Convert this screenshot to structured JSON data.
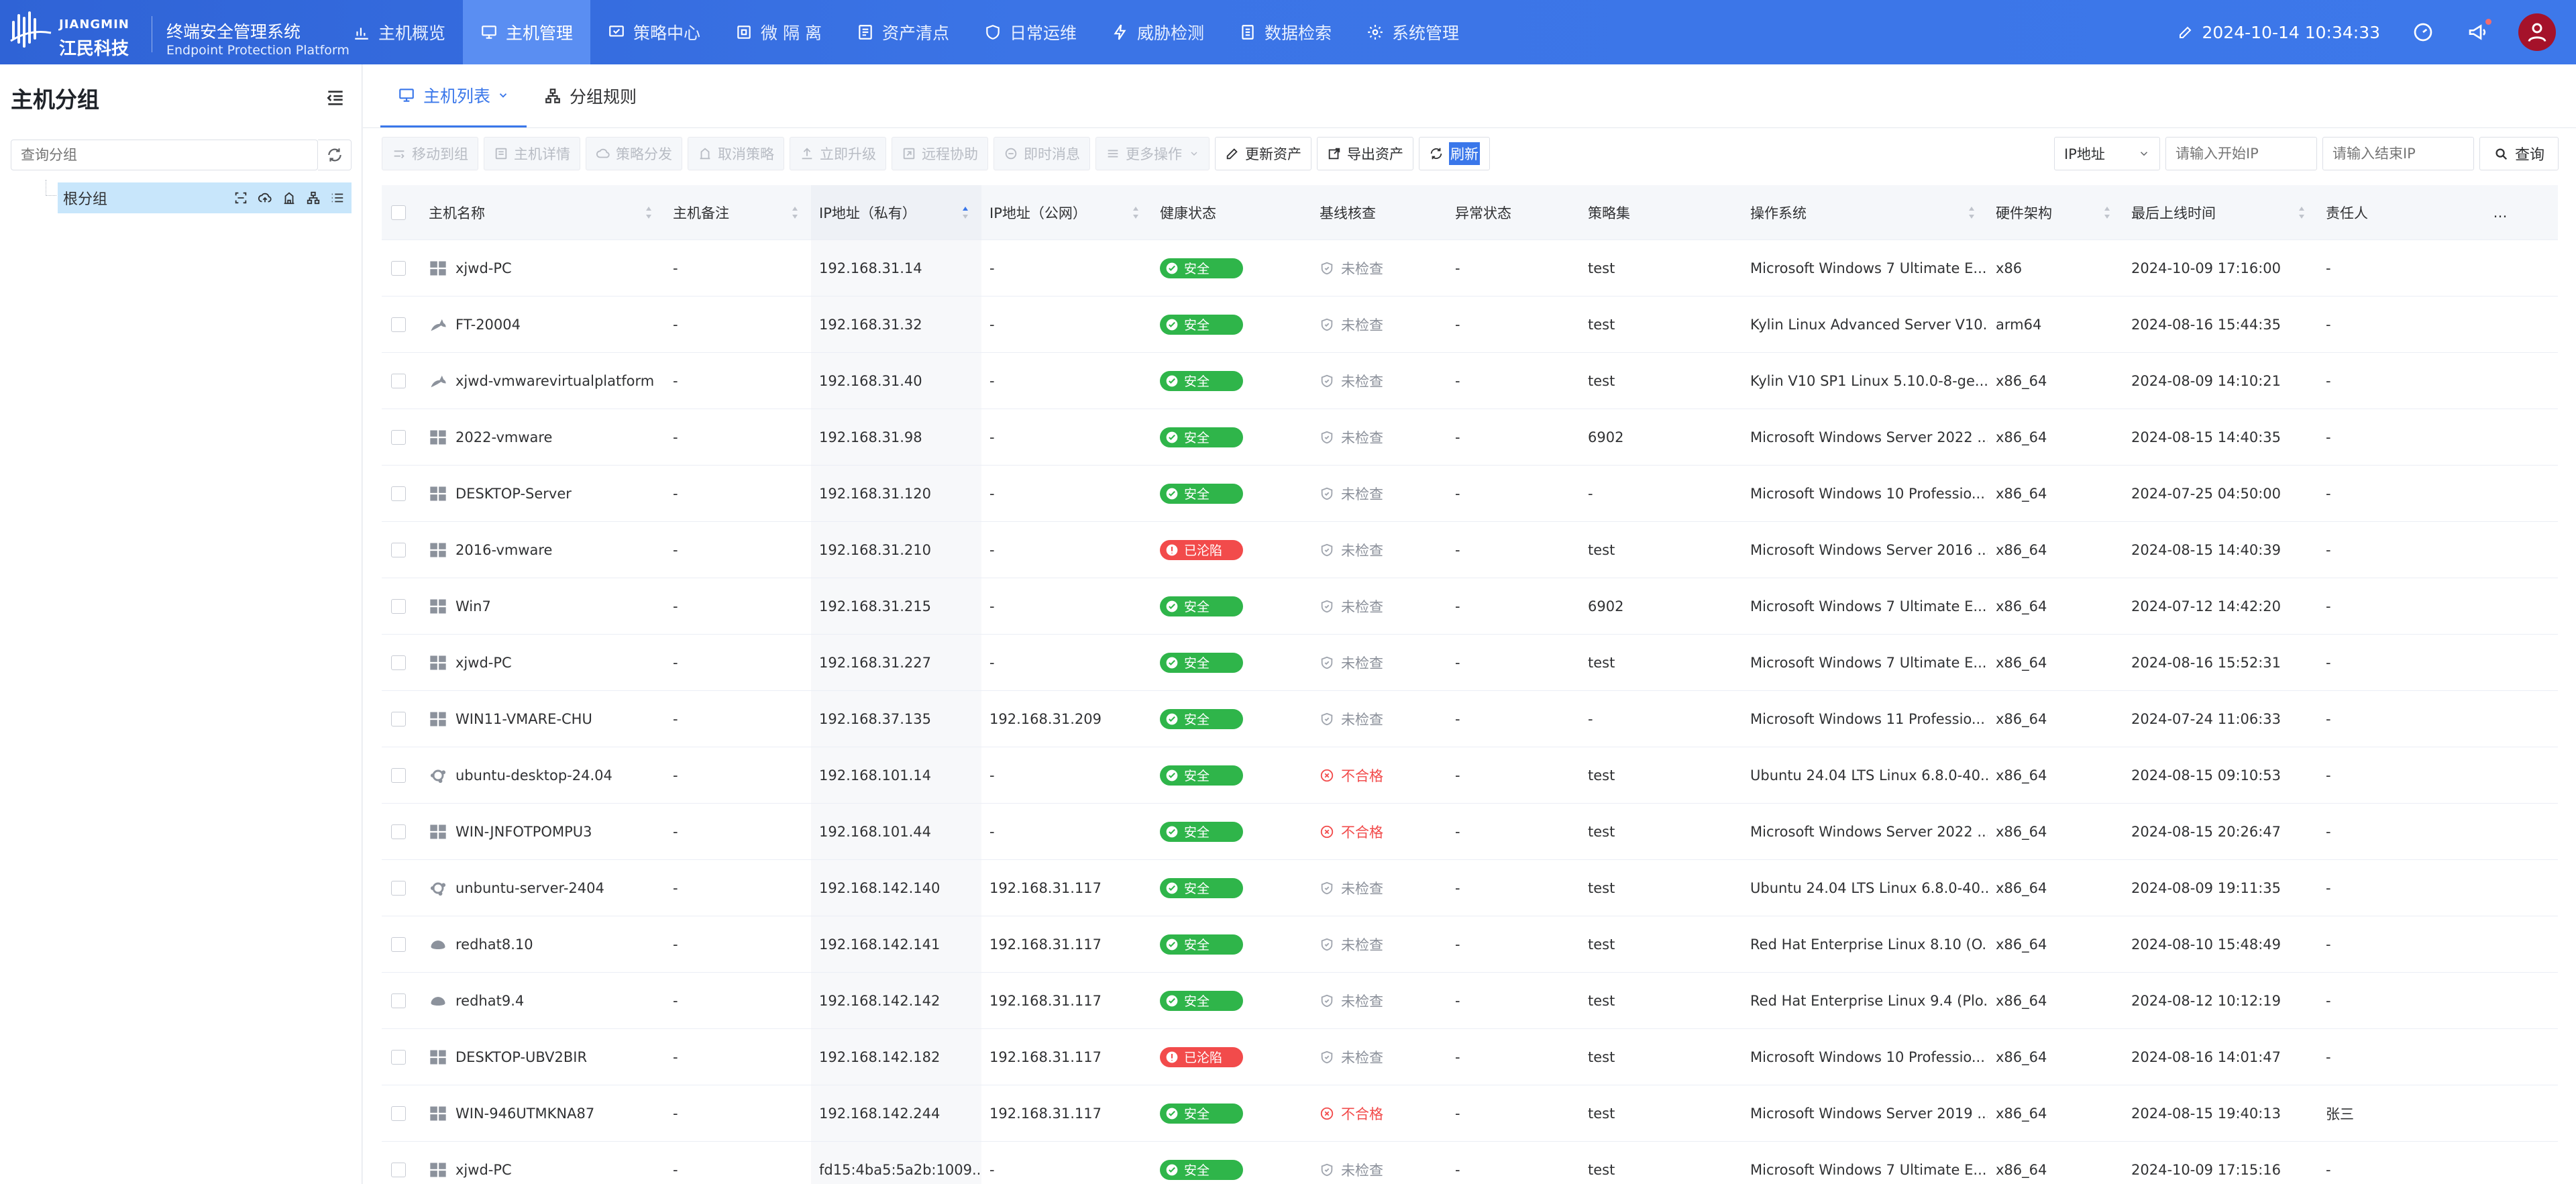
{
  "brand": {
    "name_cn": "江民科技",
    "name_en": "JIANGMIN",
    "product_cn": "终端安全管理系统",
    "product_en": "Endpoint Protection Platform"
  },
  "nav": [
    {
      "label": "主机概览",
      "icon": "bar-chart-icon"
    },
    {
      "label": "主机管理",
      "icon": "monitor-icon",
      "active": true
    },
    {
      "label": "策略中心",
      "icon": "policy-icon"
    },
    {
      "label": "微 隔 离",
      "icon": "isolation-icon"
    },
    {
      "label": "资产清点",
      "icon": "asset-icon"
    },
    {
      "label": "日常运维",
      "icon": "shield-icon"
    },
    {
      "label": "威胁检测",
      "icon": "lightning-icon"
    },
    {
      "label": "数据检索",
      "icon": "document-icon"
    },
    {
      "label": "系统管理",
      "icon": "gear-icon"
    }
  ],
  "header": {
    "datetime": "2024-10-14 10:34:33"
  },
  "sidebar": {
    "title": "主机分组",
    "search_placeholder": "查询分组",
    "root_group": "根分组"
  },
  "tabs": [
    {
      "label": "主机列表",
      "active": true
    },
    {
      "label": "分组规则"
    }
  ],
  "toolbar": {
    "move_group": "移动到组",
    "host_detail": "主机详情",
    "policy_dispatch": "策略分发",
    "cancel_policy": "取消策略",
    "upgrade_now": "立即升级",
    "remote_assist": "远程协助",
    "instant_msg": "即时消息",
    "more_actions": "更多操作",
    "update_assets": "更新资产",
    "export_assets": "导出资产",
    "refresh": "刷新"
  },
  "filters": {
    "ip_type": "IP地址",
    "start_ip_placeholder": "请输入开始IP",
    "end_ip_placeholder": "请输入结束IP",
    "query": "查询"
  },
  "columns": [
    "主机名称",
    "主机备注",
    "IP地址（私有）",
    "IP地址（公网）",
    "健康状态",
    "基线核查",
    "异常状态",
    "策略集",
    "操作系统",
    "硬件架构",
    "最后上线时间",
    "责任人",
    "…"
  ],
  "colors": {
    "accent": "#3a77ea",
    "safe": "#2fb54a",
    "danger": "#f24b4b"
  },
  "rows": [
    {
      "os": "windows",
      "name": "xjwd-PC",
      "note": "-",
      "ip_private": "192.168.31.14",
      "ip_public": "-",
      "health": "安全",
      "health_state": "ok",
      "baseline": "未检查",
      "baseline_state": "unchecked",
      "abnormal": "-",
      "policy": "test",
      "os_name": "Microsoft Windows 7 Ultimate E...",
      "arch": "x86",
      "last_online": "2024-10-09 17:16:00",
      "owner": "-"
    },
    {
      "os": "kylin",
      "name": "FT-20004",
      "note": "-",
      "ip_private": "192.168.31.32",
      "ip_public": "-",
      "health": "安全",
      "health_state": "ok",
      "baseline": "未检查",
      "baseline_state": "unchecked",
      "abnormal": "-",
      "policy": "test",
      "os_name": "Kylin Linux Advanced Server V10...",
      "arch": "arm64",
      "last_online": "2024-08-16 15:44:35",
      "owner": "-"
    },
    {
      "os": "kylin",
      "name": "xjwd-vmwarevirtualplatform",
      "note": "-",
      "ip_private": "192.168.31.40",
      "ip_public": "-",
      "health": "安全",
      "health_state": "ok",
      "baseline": "未检查",
      "baseline_state": "unchecked",
      "abnormal": "-",
      "policy": "test",
      "os_name": "Kylin V10 SP1 Linux 5.10.0-8-ge...",
      "arch": "x86_64",
      "last_online": "2024-08-09 14:10:21",
      "owner": "-"
    },
    {
      "os": "windows",
      "name": "2022-vmware",
      "note": "-",
      "ip_private": "192.168.31.98",
      "ip_public": "-",
      "health": "安全",
      "health_state": "ok",
      "baseline": "未检查",
      "baseline_state": "unchecked",
      "abnormal": "-",
      "policy": "6902",
      "os_name": "Microsoft Windows Server 2022 ...",
      "arch": "x86_64",
      "last_online": "2024-08-15 14:40:35",
      "owner": "-"
    },
    {
      "os": "windows",
      "name": "DESKTOP-Server",
      "note": "-",
      "ip_private": "192.168.31.120",
      "ip_public": "-",
      "health": "安全",
      "health_state": "ok",
      "baseline": "未检查",
      "baseline_state": "unchecked",
      "abnormal": "-",
      "policy": "-",
      "os_name": "Microsoft Windows 10 Professio...",
      "arch": "x86_64",
      "last_online": "2024-07-25 04:50:00",
      "owner": "-"
    },
    {
      "os": "windows",
      "name": "2016-vmware",
      "note": "-",
      "ip_private": "192.168.31.210",
      "ip_public": "-",
      "health": "已沦陷",
      "health_state": "bad",
      "baseline": "未检查",
      "baseline_state": "unchecked",
      "abnormal": "-",
      "policy": "test",
      "os_name": "Microsoft Windows Server 2016 ...",
      "arch": "x86_64",
      "last_online": "2024-08-15 14:40:39",
      "owner": "-"
    },
    {
      "os": "windows",
      "name": "Win7",
      "note": "-",
      "ip_private": "192.168.31.215",
      "ip_public": "-",
      "health": "安全",
      "health_state": "ok",
      "baseline": "未检查",
      "baseline_state": "unchecked",
      "abnormal": "-",
      "policy": "6902",
      "os_name": "Microsoft Windows 7 Ultimate E...",
      "arch": "x86_64",
      "last_online": "2024-07-12 14:42:20",
      "owner": "-"
    },
    {
      "os": "windows",
      "name": "xjwd-PC",
      "note": "-",
      "ip_private": "192.168.31.227",
      "ip_public": "-",
      "health": "安全",
      "health_state": "ok",
      "baseline": "未检查",
      "baseline_state": "unchecked",
      "abnormal": "-",
      "policy": "test",
      "os_name": "Microsoft Windows 7 Ultimate E...",
      "arch": "x86_64",
      "last_online": "2024-08-16 15:52:31",
      "owner": "-"
    },
    {
      "os": "windows",
      "name": "WIN11-VMARE-CHU",
      "note": "-",
      "ip_private": "192.168.37.135",
      "ip_public": "192.168.31.209",
      "health": "安全",
      "health_state": "ok",
      "baseline": "未检查",
      "baseline_state": "unchecked",
      "abnormal": "-",
      "policy": "-",
      "os_name": "Microsoft Windows 11 Professio...",
      "arch": "x86_64",
      "last_online": "2024-07-24 11:06:33",
      "owner": "-"
    },
    {
      "os": "ubuntu",
      "name": "ubuntu-desktop-24.04",
      "note": "-",
      "ip_private": "192.168.101.14",
      "ip_public": "-",
      "health": "安全",
      "health_state": "ok",
      "baseline": "不合格",
      "baseline_state": "fail",
      "abnormal": "-",
      "policy": "test",
      "os_name": "Ubuntu 24.04 LTS Linux 6.8.0-40...",
      "arch": "x86_64",
      "last_online": "2024-08-15 09:10:53",
      "owner": "-"
    },
    {
      "os": "windows",
      "name": "WIN-JNFOTPOMPU3",
      "note": "-",
      "ip_private": "192.168.101.44",
      "ip_public": "-",
      "health": "安全",
      "health_state": "ok",
      "baseline": "不合格",
      "baseline_state": "fail",
      "abnormal": "-",
      "policy": "test",
      "os_name": "Microsoft Windows Server 2022 ...",
      "arch": "x86_64",
      "last_online": "2024-08-15 20:26:47",
      "owner": "-"
    },
    {
      "os": "ubuntu",
      "name": "unbuntu-server-2404",
      "note": "-",
      "ip_private": "192.168.142.140",
      "ip_public": "192.168.31.117",
      "health": "安全",
      "health_state": "ok",
      "baseline": "未检查",
      "baseline_state": "unchecked",
      "abnormal": "-",
      "policy": "test",
      "os_name": "Ubuntu 24.04 LTS Linux 6.8.0-40...",
      "arch": "x86_64",
      "last_online": "2024-08-09 19:11:35",
      "owner": "-"
    },
    {
      "os": "redhat",
      "name": "redhat8.10",
      "note": "-",
      "ip_private": "192.168.142.141",
      "ip_public": "192.168.31.117",
      "health": "安全",
      "health_state": "ok",
      "baseline": "未检查",
      "baseline_state": "unchecked",
      "abnormal": "-",
      "policy": "test",
      "os_name": "Red Hat Enterprise Linux 8.10 (O...",
      "arch": "x86_64",
      "last_online": "2024-08-10 15:48:49",
      "owner": "-"
    },
    {
      "os": "redhat",
      "name": "redhat9.4",
      "note": "-",
      "ip_private": "192.168.142.142",
      "ip_public": "192.168.31.117",
      "health": "安全",
      "health_state": "ok",
      "baseline": "未检查",
      "baseline_state": "unchecked",
      "abnormal": "-",
      "policy": "test",
      "os_name": "Red Hat Enterprise Linux 9.4 (Plo...",
      "arch": "x86_64",
      "last_online": "2024-08-12 10:12:19",
      "owner": "-"
    },
    {
      "os": "windows",
      "name": "DESKTOP-UBV2BIR",
      "note": "-",
      "ip_private": "192.168.142.182",
      "ip_public": "192.168.31.117",
      "health": "已沦陷",
      "health_state": "bad",
      "baseline": "未检查",
      "baseline_state": "unchecked",
      "abnormal": "-",
      "policy": "test",
      "os_name": "Microsoft Windows 10 Professio...",
      "arch": "x86_64",
      "last_online": "2024-08-16 14:01:47",
      "owner": "-"
    },
    {
      "os": "windows",
      "name": "WIN-946UTMKNA87",
      "note": "-",
      "ip_private": "192.168.142.244",
      "ip_public": "192.168.31.117",
      "health": "安全",
      "health_state": "ok",
      "baseline": "不合格",
      "baseline_state": "fail",
      "abnormal": "-",
      "policy": "test",
      "os_name": "Microsoft Windows Server 2019 ...",
      "arch": "x86_64",
      "last_online": "2024-08-15 19:40:13",
      "owner": "张三"
    },
    {
      "os": "windows",
      "name": "xjwd-PC",
      "note": "-",
      "ip_private": "fd15:4ba5:5a2b:1009...",
      "ip_public": "-",
      "health": "安全",
      "health_state": "ok",
      "baseline": "未检查",
      "baseline_state": "unchecked",
      "abnormal": "-",
      "policy": "test",
      "os_name": "Microsoft Windows 7 Ultimate E...",
      "arch": "x86_64",
      "last_online": "2024-10-09 17:15:16",
      "owner": "-"
    }
  ]
}
